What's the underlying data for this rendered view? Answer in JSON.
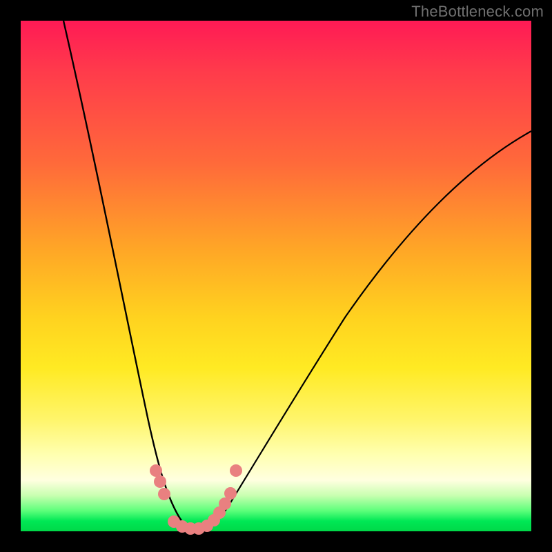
{
  "watermark": "TheBottleneck.com",
  "colors": {
    "page_bg": "#000000",
    "curve_stroke": "#000000",
    "marker_fill": "#e98080",
    "gradient": [
      "#ff1a55",
      "#ff6a3a",
      "#ffd21f",
      "#ffffe0",
      "#00d848"
    ]
  },
  "chart_data": {
    "type": "line",
    "title": "",
    "xlabel": "",
    "ylabel": "",
    "xlim": [
      0,
      100
    ],
    "ylim": [
      0,
      100
    ],
    "grid": false,
    "legend": false,
    "note": "V-shaped bottleneck curve; values approach ~0 near x≈30–35 and rise toward 100 at extremes. No axis ticks are shown; values are estimated from curve geometry.",
    "series": [
      {
        "name": "bottleneck-curve",
        "x": [
          5,
          10,
          15,
          20,
          22,
          24,
          26,
          28,
          30,
          32,
          34,
          36,
          38,
          40,
          45,
          50,
          55,
          60,
          65,
          70,
          75,
          80,
          85,
          90,
          95,
          100
        ],
        "values": [
          100,
          82,
          62,
          42,
          33,
          24,
          16,
          9,
          4,
          1,
          0,
          0,
          1,
          3,
          8,
          15,
          22,
          30,
          38,
          46,
          53,
          60,
          66,
          71,
          75,
          78
        ]
      }
    ],
    "markers": [
      {
        "x": 26.5,
        "y": 11
      },
      {
        "x": 27.3,
        "y": 9
      },
      {
        "x": 28.0,
        "y": 7
      },
      {
        "x": 30.0,
        "y": 1.5
      },
      {
        "x": 31.5,
        "y": 0.8
      },
      {
        "x": 33.0,
        "y": 0.5
      },
      {
        "x": 34.5,
        "y": 0.6
      },
      {
        "x": 36.0,
        "y": 1.2
      },
      {
        "x": 37.5,
        "y": 2.3
      },
      {
        "x": 38.5,
        "y": 3.5
      },
      {
        "x": 39.5,
        "y": 5.0
      },
      {
        "x": 40.5,
        "y": 7.0
      },
      {
        "x": 41.5,
        "y": 11.5
      }
    ]
  }
}
